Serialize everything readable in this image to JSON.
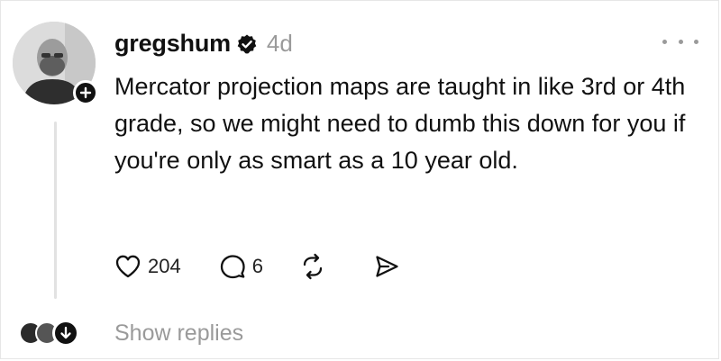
{
  "post": {
    "author": "gregshum",
    "verified": true,
    "time": "4d",
    "text": "Mercator projection maps are taught in like 3rd or 4th grade, so we might need to dumb this down for you if you're only as smart as a 10 year old.",
    "likes": "204",
    "replies": "6"
  },
  "thread": {
    "show_replies_label": "Show replies"
  },
  "colors": {
    "text": "#111111",
    "muted": "#9a9a9a",
    "verified_badge": "#111111",
    "thread_line": "#e2e2e2"
  },
  "icons": {
    "follow": "plus-icon",
    "verified": "verified-badge-icon",
    "more": "more-horizontal-icon",
    "like": "heart-icon",
    "reply": "comment-icon",
    "repost": "repost-icon",
    "share": "send-icon",
    "expand": "arrow-down-icon"
  }
}
